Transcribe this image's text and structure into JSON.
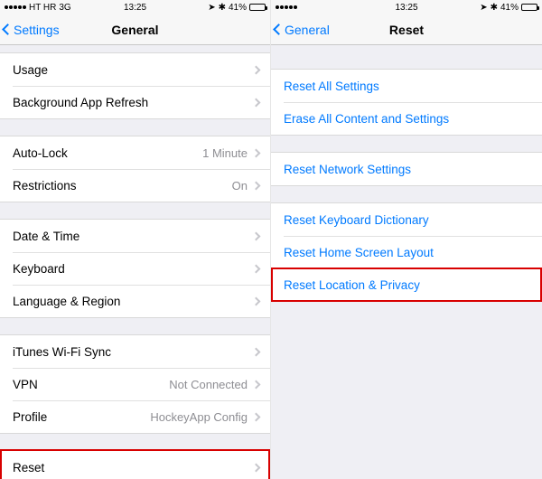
{
  "status": {
    "carrier": "HT HR",
    "network": "3G",
    "time": "13:25",
    "battery": "41%",
    "bt_glyph": "✱",
    "loc_glyph": "➤"
  },
  "left": {
    "back": "Settings",
    "title": "General",
    "g1": {
      "usage": "Usage",
      "bgrefresh": "Background App Refresh"
    },
    "g2": {
      "autolock": "Auto-Lock",
      "autolock_v": "1 Minute",
      "restrictions": "Restrictions",
      "restrictions_v": "On"
    },
    "g3": {
      "date": "Date & Time",
      "keyboard": "Keyboard",
      "lang": "Language & Region"
    },
    "g4": {
      "itunes": "iTunes Wi-Fi Sync",
      "vpn": "VPN",
      "vpn_v": "Not Connected",
      "profile": "Profile",
      "profile_v": "HockeyApp Config"
    },
    "g5": {
      "reset": "Reset"
    }
  },
  "right": {
    "back": "General",
    "title": "Reset",
    "g1": {
      "all": "Reset All Settings",
      "erase": "Erase All Content and Settings"
    },
    "g2": {
      "network": "Reset Network Settings"
    },
    "g3": {
      "kb": "Reset Keyboard Dictionary",
      "home": "Reset Home Screen Layout",
      "loc": "Reset Location & Privacy"
    }
  }
}
